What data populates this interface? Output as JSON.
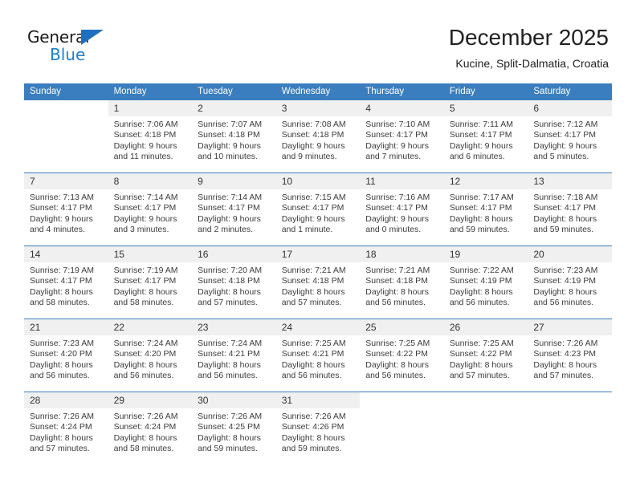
{
  "brand": {
    "name_part1": "General",
    "name_part2": "Blue",
    "triangle_color": "#1f6fc0",
    "blue_color": "#1b7fd4"
  },
  "header": {
    "title": "December 2025",
    "location": "Kucine, Split-Dalmatia, Croatia"
  },
  "theme": {
    "header_blue": "#3a7ebf",
    "daynum_band": "#f0f0f0",
    "text": "#3b3b3b"
  },
  "columns": [
    "Sunday",
    "Monday",
    "Tuesday",
    "Wednesday",
    "Thursday",
    "Friday",
    "Saturday"
  ],
  "weeks": [
    [
      {
        "day": "",
        "lines": [
          "",
          "",
          "",
          ""
        ]
      },
      {
        "day": "1",
        "lines": [
          "Sunrise: 7:06 AM",
          "Sunset: 4:18 PM",
          "Daylight: 9 hours",
          "and 11 minutes."
        ]
      },
      {
        "day": "2",
        "lines": [
          "Sunrise: 7:07 AM",
          "Sunset: 4:18 PM",
          "Daylight: 9 hours",
          "and 10 minutes."
        ]
      },
      {
        "day": "3",
        "lines": [
          "Sunrise: 7:08 AM",
          "Sunset: 4:18 PM",
          "Daylight: 9 hours",
          "and 9 minutes."
        ]
      },
      {
        "day": "4",
        "lines": [
          "Sunrise: 7:10 AM",
          "Sunset: 4:17 PM",
          "Daylight: 9 hours",
          "and 7 minutes."
        ]
      },
      {
        "day": "5",
        "lines": [
          "Sunrise: 7:11 AM",
          "Sunset: 4:17 PM",
          "Daylight: 9 hours",
          "and 6 minutes."
        ]
      },
      {
        "day": "6",
        "lines": [
          "Sunrise: 7:12 AM",
          "Sunset: 4:17 PM",
          "Daylight: 9 hours",
          "and 5 minutes."
        ]
      }
    ],
    [
      {
        "day": "7",
        "lines": [
          "Sunrise: 7:13 AM",
          "Sunset: 4:17 PM",
          "Daylight: 9 hours",
          "and 4 minutes."
        ]
      },
      {
        "day": "8",
        "lines": [
          "Sunrise: 7:14 AM",
          "Sunset: 4:17 PM",
          "Daylight: 9 hours",
          "and 3 minutes."
        ]
      },
      {
        "day": "9",
        "lines": [
          "Sunrise: 7:14 AM",
          "Sunset: 4:17 PM",
          "Daylight: 9 hours",
          "and 2 minutes."
        ]
      },
      {
        "day": "10",
        "lines": [
          "Sunrise: 7:15 AM",
          "Sunset: 4:17 PM",
          "Daylight: 9 hours",
          "and 1 minute."
        ]
      },
      {
        "day": "11",
        "lines": [
          "Sunrise: 7:16 AM",
          "Sunset: 4:17 PM",
          "Daylight: 9 hours",
          "and 0 minutes."
        ]
      },
      {
        "day": "12",
        "lines": [
          "Sunrise: 7:17 AM",
          "Sunset: 4:17 PM",
          "Daylight: 8 hours",
          "and 59 minutes."
        ]
      },
      {
        "day": "13",
        "lines": [
          "Sunrise: 7:18 AM",
          "Sunset: 4:17 PM",
          "Daylight: 8 hours",
          "and 59 minutes."
        ]
      }
    ],
    [
      {
        "day": "14",
        "lines": [
          "Sunrise: 7:19 AM",
          "Sunset: 4:17 PM",
          "Daylight: 8 hours",
          "and 58 minutes."
        ]
      },
      {
        "day": "15",
        "lines": [
          "Sunrise: 7:19 AM",
          "Sunset: 4:17 PM",
          "Daylight: 8 hours",
          "and 58 minutes."
        ]
      },
      {
        "day": "16",
        "lines": [
          "Sunrise: 7:20 AM",
          "Sunset: 4:18 PM",
          "Daylight: 8 hours",
          "and 57 minutes."
        ]
      },
      {
        "day": "17",
        "lines": [
          "Sunrise: 7:21 AM",
          "Sunset: 4:18 PM",
          "Daylight: 8 hours",
          "and 57 minutes."
        ]
      },
      {
        "day": "18",
        "lines": [
          "Sunrise: 7:21 AM",
          "Sunset: 4:18 PM",
          "Daylight: 8 hours",
          "and 56 minutes."
        ]
      },
      {
        "day": "19",
        "lines": [
          "Sunrise: 7:22 AM",
          "Sunset: 4:19 PM",
          "Daylight: 8 hours",
          "and 56 minutes."
        ]
      },
      {
        "day": "20",
        "lines": [
          "Sunrise: 7:23 AM",
          "Sunset: 4:19 PM",
          "Daylight: 8 hours",
          "and 56 minutes."
        ]
      }
    ],
    [
      {
        "day": "21",
        "lines": [
          "Sunrise: 7:23 AM",
          "Sunset: 4:20 PM",
          "Daylight: 8 hours",
          "and 56 minutes."
        ]
      },
      {
        "day": "22",
        "lines": [
          "Sunrise: 7:24 AM",
          "Sunset: 4:20 PM",
          "Daylight: 8 hours",
          "and 56 minutes."
        ]
      },
      {
        "day": "23",
        "lines": [
          "Sunrise: 7:24 AM",
          "Sunset: 4:21 PM",
          "Daylight: 8 hours",
          "and 56 minutes."
        ]
      },
      {
        "day": "24",
        "lines": [
          "Sunrise: 7:25 AM",
          "Sunset: 4:21 PM",
          "Daylight: 8 hours",
          "and 56 minutes."
        ]
      },
      {
        "day": "25",
        "lines": [
          "Sunrise: 7:25 AM",
          "Sunset: 4:22 PM",
          "Daylight: 8 hours",
          "and 56 minutes."
        ]
      },
      {
        "day": "26",
        "lines": [
          "Sunrise: 7:25 AM",
          "Sunset: 4:22 PM",
          "Daylight: 8 hours",
          "and 57 minutes."
        ]
      },
      {
        "day": "27",
        "lines": [
          "Sunrise: 7:26 AM",
          "Sunset: 4:23 PM",
          "Daylight: 8 hours",
          "and 57 minutes."
        ]
      }
    ],
    [
      {
        "day": "28",
        "lines": [
          "Sunrise: 7:26 AM",
          "Sunset: 4:24 PM",
          "Daylight: 8 hours",
          "and 57 minutes."
        ]
      },
      {
        "day": "29",
        "lines": [
          "Sunrise: 7:26 AM",
          "Sunset: 4:24 PM",
          "Daylight: 8 hours",
          "and 58 minutes."
        ]
      },
      {
        "day": "30",
        "lines": [
          "Sunrise: 7:26 AM",
          "Sunset: 4:25 PM",
          "Daylight: 8 hours",
          "and 59 minutes."
        ]
      },
      {
        "day": "31",
        "lines": [
          "Sunrise: 7:26 AM",
          "Sunset: 4:26 PM",
          "Daylight: 8 hours",
          "and 59 minutes."
        ]
      },
      {
        "day": "",
        "lines": [
          "",
          "",
          "",
          ""
        ]
      },
      {
        "day": "",
        "lines": [
          "",
          "",
          "",
          ""
        ]
      },
      {
        "day": "",
        "lines": [
          "",
          "",
          "",
          ""
        ]
      }
    ]
  ]
}
